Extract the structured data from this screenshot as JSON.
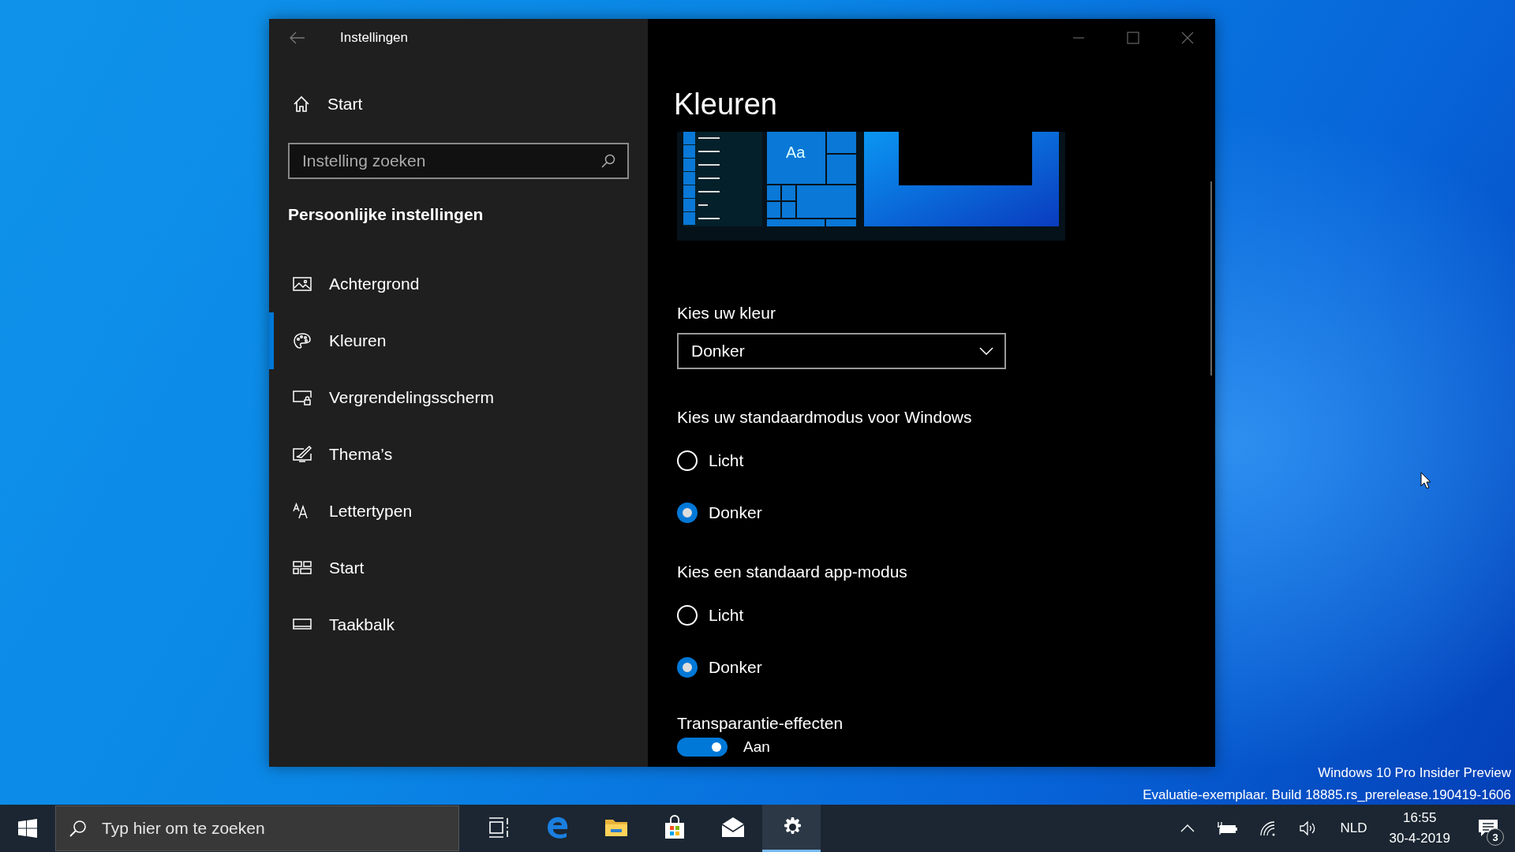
{
  "window": {
    "title": "Instellingen"
  },
  "sidebar": {
    "home": "Start",
    "search": {
      "placeholder": "Instelling zoeken"
    },
    "section": "Persoonlijke instellingen",
    "items": [
      {
        "label": "Achtergrond",
        "selected": false
      },
      {
        "label": "Kleuren",
        "selected": true
      },
      {
        "label": "Vergrendelingsscherm",
        "selected": false
      },
      {
        "label": "Thema’s",
        "selected": false
      },
      {
        "label": "Lettertypen",
        "selected": false
      },
      {
        "label": "Start",
        "selected": false
      },
      {
        "label": "Taakbalk",
        "selected": false
      }
    ]
  },
  "page": {
    "title": "Kleuren",
    "preview_text": "Aa",
    "color": {
      "label": "Kies uw kleur",
      "value": "Donker"
    },
    "groups": [
      {
        "label": "Kies uw standaardmodus voor Windows",
        "options": [
          {
            "label": "Licht",
            "selected": false
          },
          {
            "label": "Donker",
            "selected": true
          }
        ]
      },
      {
        "label": "Kies een standaard app-modus",
        "options": [
          {
            "label": "Licht",
            "selected": false
          },
          {
            "label": "Donker",
            "selected": true
          }
        ]
      }
    ],
    "transparency": {
      "label": "Transparantie-effecten",
      "on": true,
      "state": "Aan"
    }
  },
  "desktop": {
    "notice": [
      "Windows 10 Pro Insider Preview",
      "Evaluatie-exemplaar. Build 18885.rs_prerelease.190419-1606"
    ]
  },
  "taskbar": {
    "search": {
      "placeholder": "Typ hier om te zoeken"
    },
    "apps": [
      {
        "active": false
      },
      {
        "active": false
      },
      {
        "active": false
      },
      {
        "active": false
      },
      {
        "active": false
      },
      {
        "active": true
      }
    ],
    "language": "NLD",
    "time": "16:55",
    "date": "30-4-2019",
    "notifications": "3"
  }
}
